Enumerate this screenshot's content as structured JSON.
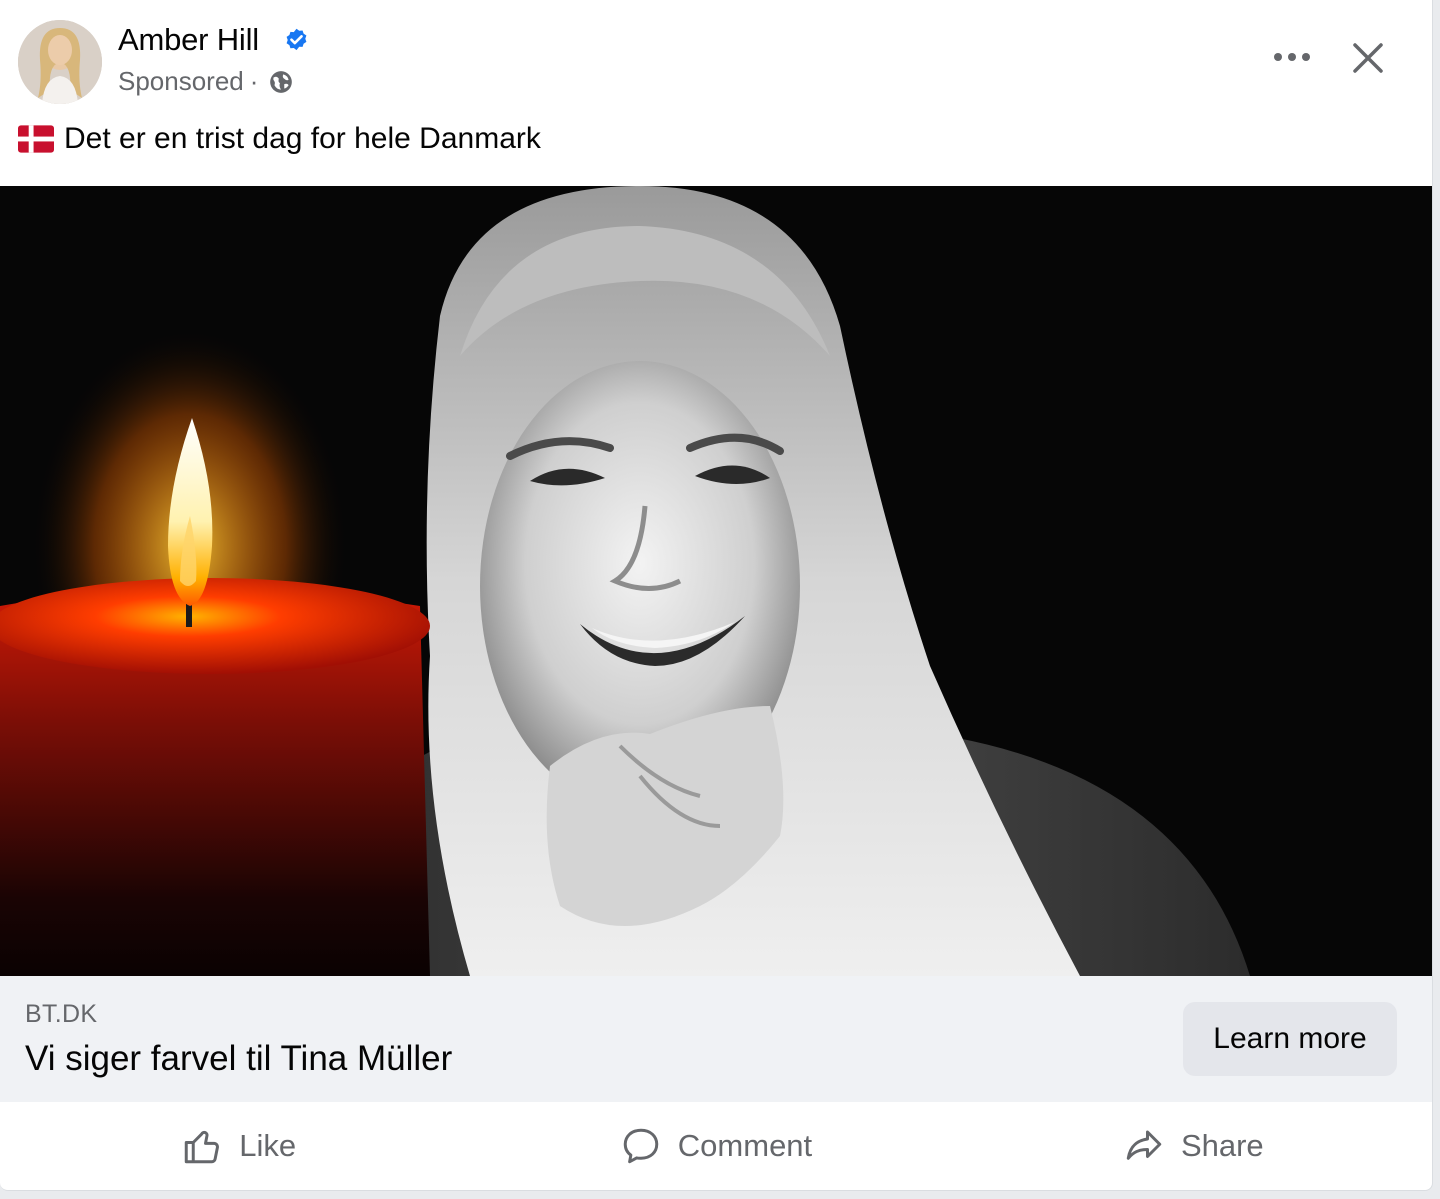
{
  "post": {
    "author": {
      "name": "Amber Hill",
      "verified": true,
      "avatar_icon": "profile-photo"
    },
    "meta": {
      "sponsored_label": "Sponsored",
      "separator": "·",
      "audience_icon": "globe-icon"
    },
    "menu_icon": "more-horizontal-icon",
    "close_icon": "close-icon",
    "caption": {
      "flag_icon": "denmark-flag",
      "text": "Det er en trist dag for hele Danmark"
    },
    "media": {
      "kind": "photo",
      "subject": "black-and-white portrait beside a lit red candle"
    },
    "link": {
      "domain": "BT.DK",
      "headline": "Vi siger farvel til Tina Müller",
      "cta_label": "Learn more"
    },
    "actions": [
      {
        "label": "Like",
        "icon": "thumbs-up-icon"
      },
      {
        "label": "Comment",
        "icon": "comment-icon"
      },
      {
        "label": "Share",
        "icon": "share-icon"
      }
    ]
  },
  "colors": {
    "verified_badge": "#1877f2",
    "secondary_text": "#65676b",
    "primary_text": "#050505",
    "link_bar_bg": "#f0f2f5",
    "button_bg": "#e4e6eb",
    "flag_red": "#c8102e"
  }
}
